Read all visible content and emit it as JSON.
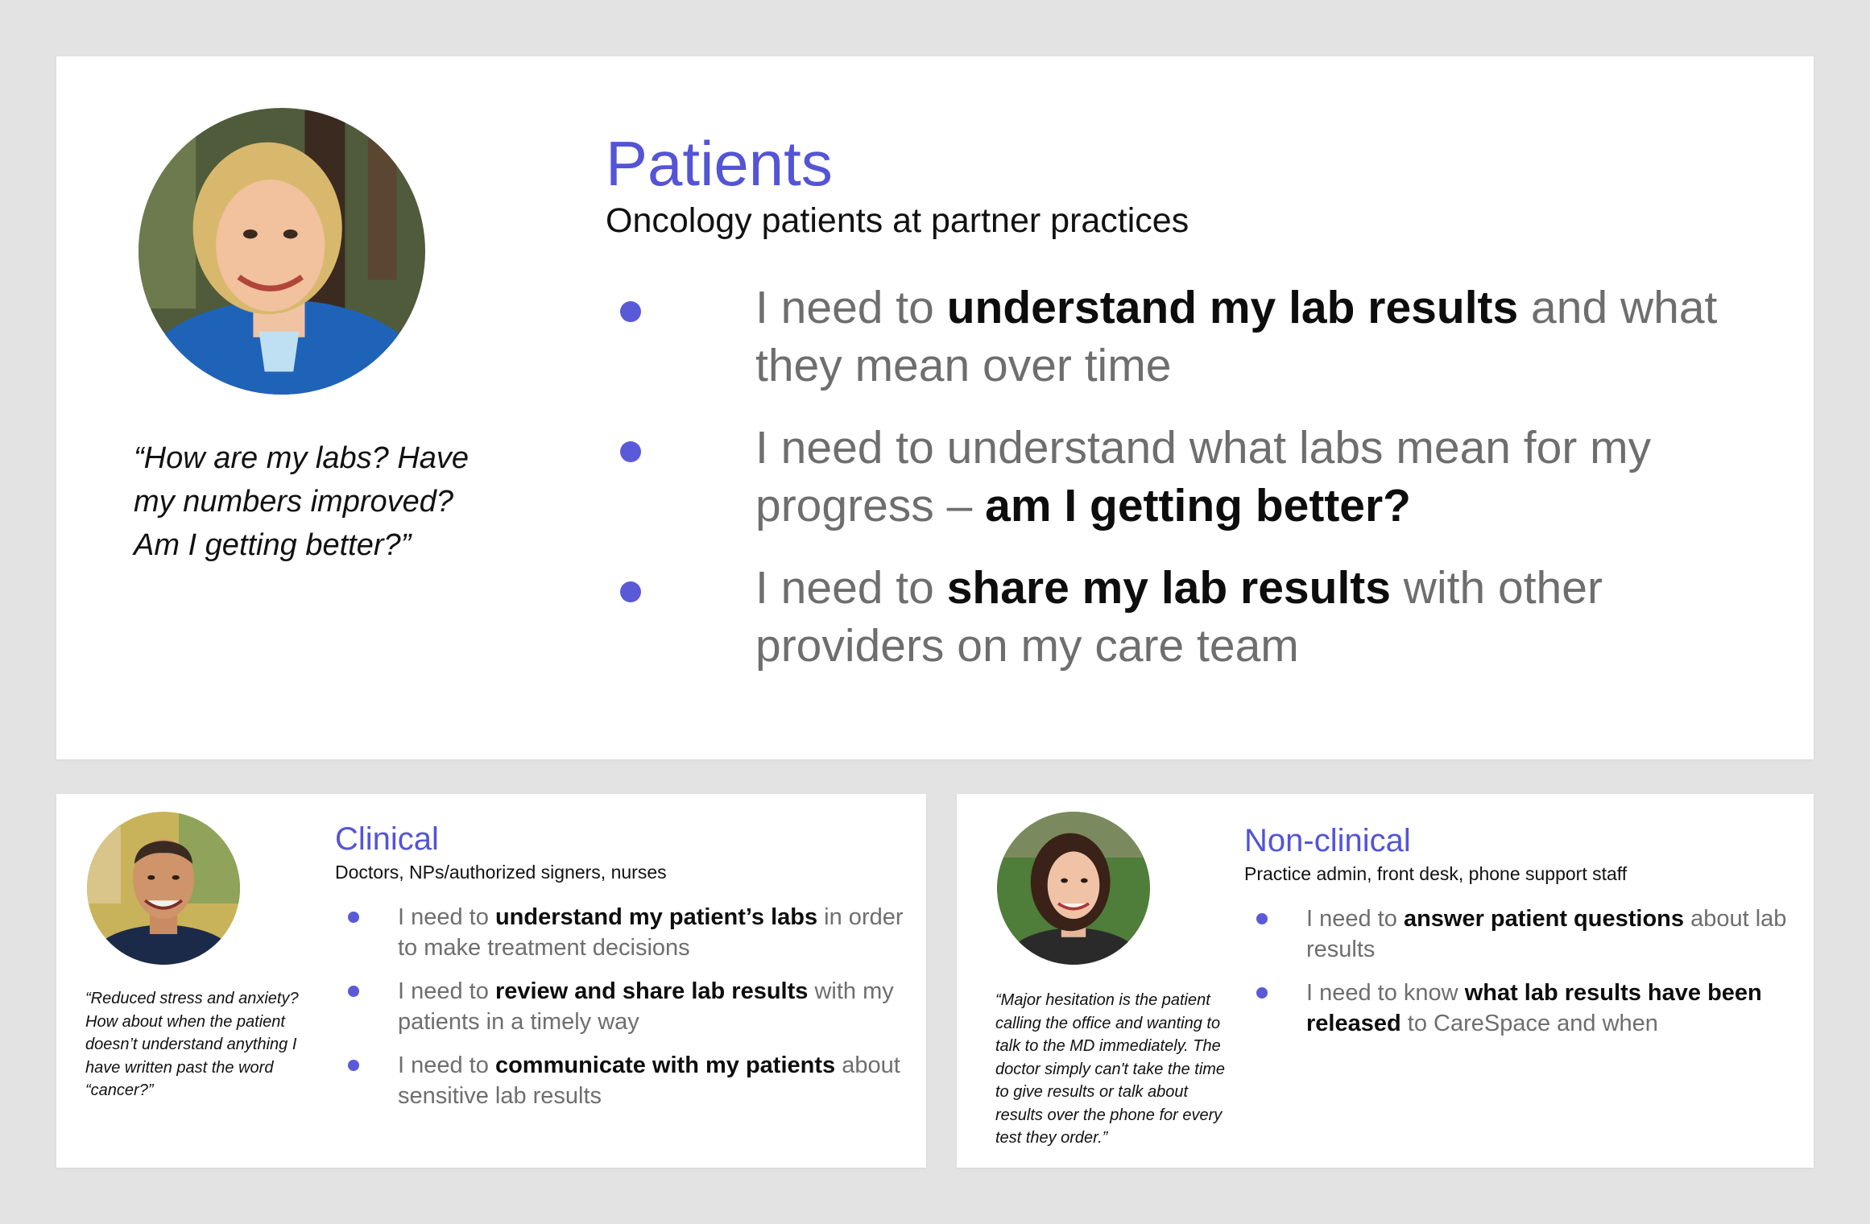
{
  "colors": {
    "background": "#e3e3e3",
    "card": "#ffffff",
    "accent": "#5454d6",
    "bullet": "#5a5ad8",
    "muted_text": "#6e6e6e",
    "strong_text": "#0d0d0d"
  },
  "patients": {
    "title": "Patients",
    "subtitle": "Oncology patients at partner practices",
    "quote": "“How are my labs? Have my numbers improved? Am I getting better?”",
    "needs": [
      [
        {
          "t": "I need to ",
          "b": false
        },
        {
          "t": "understand my lab results",
          "b": true
        },
        {
          "t": " and what they mean over time",
          "b": false
        }
      ],
      [
        {
          "t": "I need to understand what labs mean for my progress – ",
          "b": false
        },
        {
          "t": "am I getting better?",
          "b": true
        }
      ],
      [
        {
          "t": "I need to ",
          "b": false
        },
        {
          "t": "share my lab results",
          "b": true
        },
        {
          "t": " with other providers on my care team",
          "b": false
        }
      ]
    ]
  },
  "clinical": {
    "title": "Clinical",
    "subtitle": "Doctors, NPs/authorized signers, nurses",
    "quote": "“Reduced stress and anxiety? How about when the patient doesn’t understand anything I have written past the word “cancer?”",
    "needs": [
      [
        {
          "t": "I need to ",
          "b": false
        },
        {
          "t": "understand my patient’s labs",
          "b": true
        },
        {
          "t": " in order to make treatment decisions",
          "b": false
        }
      ],
      [
        {
          "t": "I need to ",
          "b": false
        },
        {
          "t": "review and share lab results",
          "b": true
        },
        {
          "t": " with my patients in a timely way",
          "b": false
        }
      ],
      [
        {
          "t": "I need to ",
          "b": false
        },
        {
          "t": "communicate with my patients",
          "b": true
        },
        {
          "t": " about sensitive lab results",
          "b": false
        }
      ]
    ]
  },
  "nonclinical": {
    "title": "Non-clinical",
    "subtitle": "Practice admin, front desk, phone support staff",
    "quote": "“Major hesitation is the patient calling the office and wanting to talk to the MD immediately. The doctor simply can't take the time to give results or talk about results over the phone for every test they order.”",
    "needs": [
      [
        {
          "t": "I need to ",
          "b": false
        },
        {
          "t": "answer patient questions",
          "b": true
        },
        {
          "t": " about lab results",
          "b": false
        }
      ],
      [
        {
          "t": "I need to know ",
          "b": false
        },
        {
          "t": "what lab results have been released",
          "b": true
        },
        {
          "t": " to CareSpace and when",
          "b": false
        }
      ]
    ]
  }
}
